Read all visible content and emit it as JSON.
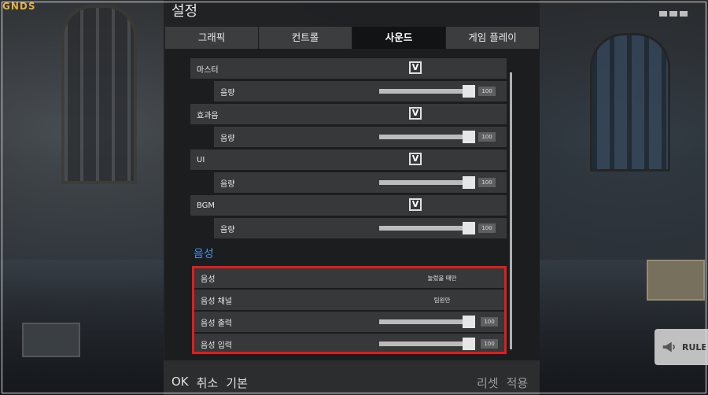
{
  "corner_brand": "GNDS",
  "rules_button": {
    "label": "RULE"
  },
  "settings": {
    "title": "설정",
    "tabs": [
      {
        "label": "그래픽",
        "active": false
      },
      {
        "label": "컨트롤",
        "active": false
      },
      {
        "label": "사운드",
        "active": true
      },
      {
        "label": "게임 플레이",
        "active": false
      }
    ],
    "sound": [
      {
        "label": "마스터",
        "enabled": "V",
        "volume_label": "음량",
        "volume": "100"
      },
      {
        "label": "효과음",
        "enabled": "V",
        "volume_label": "음량",
        "volume": "100"
      },
      {
        "label": "UI",
        "enabled": "V",
        "volume_label": "음량",
        "volume": "100"
      },
      {
        "label": "BGM",
        "enabled": "V",
        "volume_label": "음량",
        "volume": "100"
      }
    ],
    "voice_section": {
      "title": "음성",
      "rows": [
        {
          "label": "음성",
          "value": "눌렀을 때만"
        },
        {
          "label": "음성 채널",
          "value": "팀원만"
        },
        {
          "label": "음성 출력",
          "volume": "100"
        },
        {
          "label": "음성 입력",
          "volume": "100"
        }
      ]
    },
    "bottom": {
      "left": [
        "OK",
        "취소",
        "기본"
      ],
      "right": [
        "리셋",
        "적용"
      ]
    }
  },
  "colors": {
    "accent_blue": "#4b8fe0",
    "highlight_red": "#e51b1b"
  }
}
